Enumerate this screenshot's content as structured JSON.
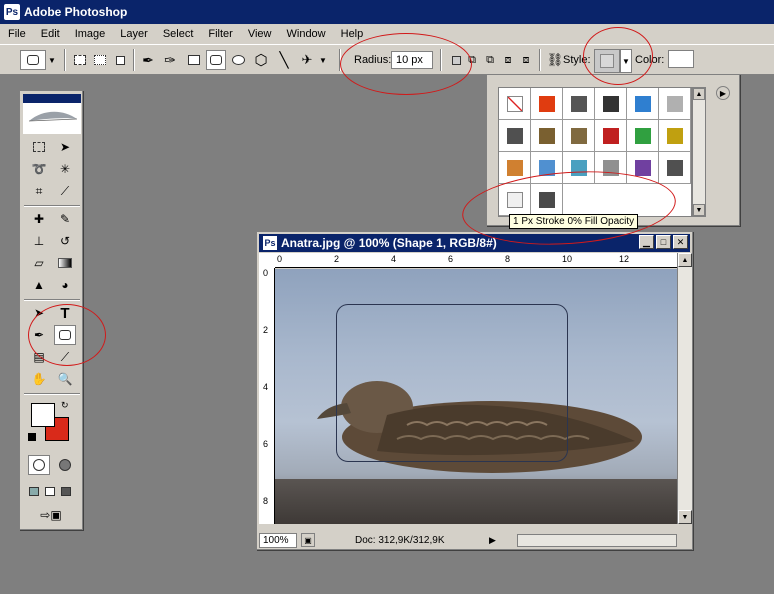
{
  "app": {
    "title": "Adobe Photoshop",
    "icon": "ps-icon"
  },
  "menu": [
    "File",
    "Edit",
    "Image",
    "Layer",
    "Select",
    "Filter",
    "View",
    "Window",
    "Help"
  ],
  "options_bar": {
    "radius_label": "Radius:",
    "radius_value": "10 px",
    "style_label": "Style:",
    "color_label": "Color:",
    "color_value": "#ffffff"
  },
  "style_panel": {
    "tooltip": "1 Px Stroke 0% Fill Opacity",
    "swatches": [
      "#ffffff",
      "#e03c10",
      "#555555",
      "#333333",
      "#2f7fd0",
      "#b0b0b0",
      "#505050",
      "#7a6030",
      "#806a40",
      "#c02020",
      "#30a040",
      "#c0a010",
      "#d08030",
      "#5090d0",
      "#4aa0c0",
      "#909090",
      "#7040a0",
      "#505050",
      "#f0f0f0",
      "#4a4a4a"
    ]
  },
  "document": {
    "title": "Anatra.jpg @ 100% (Shape 1, RGB/8#)",
    "zoom": "100%",
    "doc_info": "Doc: 312,9K/312,9K",
    "h_ruler": [
      "0",
      "2",
      "4",
      "6",
      "8",
      "10",
      "12"
    ],
    "v_ruler": [
      "0",
      "2",
      "4",
      "6",
      "8"
    ]
  },
  "toolbox": {
    "foreground": "#ffffff",
    "background": "#d92a1a"
  },
  "colors": {
    "titlebar": "#0a246a",
    "chrome": "#d4d0c8",
    "workspace": "#7f7f7f",
    "annotation": "#d11a1a"
  }
}
